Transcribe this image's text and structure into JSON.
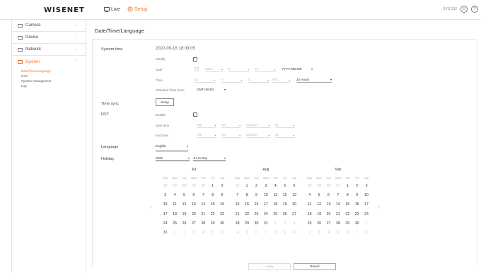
{
  "header": {
    "logo": "WISENET",
    "nav": [
      {
        "label": "Live",
        "icon": "monitor-icon"
      },
      {
        "label": "Setup",
        "icon": "gear-icon"
      }
    ],
    "device_id": "SYS 132",
    "icons": [
      "user-icon",
      "help-icon"
    ]
  },
  "sidebar": {
    "items": [
      {
        "label": "Camera",
        "icon": "camera-icon"
      },
      {
        "label": "Device",
        "icon": "device-icon"
      },
      {
        "label": "Network",
        "icon": "network-icon"
      },
      {
        "label": "System",
        "icon": "system-icon"
      }
    ],
    "submenu": [
      "Date/Time/Language",
      "User",
      "System management",
      "Log"
    ]
  },
  "page": {
    "title": "Date/Time/Language",
    "system_time_label": "System time",
    "system_time_value": "2022-09-16 18:09:05",
    "modify_label": "Modify",
    "date_label": "Date",
    "date_year": "2022",
    "date_month": "9",
    "date_day": "16",
    "date_format": "YYYY-MM-DD",
    "time_label": "Time",
    "time_h": "18",
    "time_m": "9",
    "time_s": "5",
    "time_ampm": "PM",
    "time_format": "24 Hours",
    "tz_label": "Standard Time Zone",
    "tz_value": "GMT+09:00",
    "time_sync_label": "Time sync",
    "setup_button": "Setup",
    "dst_label": "DST",
    "enable_label": "Enable",
    "start_time_label": "Start time",
    "end_time_label": "End time",
    "dst_month": "Mar",
    "dst_week": "1st",
    "dst_day": "Sunday",
    "dst_hour": "01",
    "language_label": "Language",
    "language_value": "English",
    "holiday_label": "Holiday",
    "holiday_year": "2022",
    "holiday_range": "Jul to Sep",
    "apply_button": "Apply",
    "revert_button": "Revert"
  },
  "calendar": {
    "dow": [
      "Sun",
      "Mon",
      "Tue",
      "Wed",
      "Thu",
      "Fri",
      "Sat"
    ],
    "months": [
      {
        "name": "Jul",
        "days": [
          [
            "26",
            "m"
          ],
          [
            "27",
            "m"
          ],
          [
            "28",
            "m"
          ],
          [
            "29",
            "m"
          ],
          [
            "30",
            "m"
          ],
          [
            "1",
            ""
          ],
          [
            "2",
            ""
          ],
          [
            "3",
            ""
          ],
          [
            "4",
            ""
          ],
          [
            "5",
            ""
          ],
          [
            "6",
            ""
          ],
          [
            "7",
            ""
          ],
          [
            "8",
            ""
          ],
          [
            "9",
            ""
          ],
          [
            "10",
            ""
          ],
          [
            "11",
            ""
          ],
          [
            "12",
            ""
          ],
          [
            "13",
            ""
          ],
          [
            "14",
            ""
          ],
          [
            "15",
            ""
          ],
          [
            "16",
            ""
          ],
          [
            "17",
            ""
          ],
          [
            "18",
            ""
          ],
          [
            "19",
            ""
          ],
          [
            "20",
            ""
          ],
          [
            "21",
            ""
          ],
          [
            "22",
            ""
          ],
          [
            "23",
            ""
          ],
          [
            "24",
            ""
          ],
          [
            "25",
            ""
          ],
          [
            "26",
            ""
          ],
          [
            "27",
            ""
          ],
          [
            "28",
            ""
          ],
          [
            "29",
            ""
          ],
          [
            "30",
            ""
          ],
          [
            "31",
            ""
          ],
          [
            "1",
            "m"
          ],
          [
            "2",
            "m"
          ],
          [
            "3",
            "m"
          ],
          [
            "4",
            "m"
          ],
          [
            "5",
            "m"
          ],
          [
            "6",
            "m"
          ]
        ]
      },
      {
        "name": "Aug",
        "days": [
          [
            "31",
            "m"
          ],
          [
            "1",
            ""
          ],
          [
            "2",
            ""
          ],
          [
            "3",
            ""
          ],
          [
            "4",
            ""
          ],
          [
            "5",
            ""
          ],
          [
            "6",
            ""
          ],
          [
            "7",
            ""
          ],
          [
            "8",
            ""
          ],
          [
            "9",
            ""
          ],
          [
            "10",
            ""
          ],
          [
            "11",
            ""
          ],
          [
            "12",
            ""
          ],
          [
            "13",
            ""
          ],
          [
            "14",
            ""
          ],
          [
            "15",
            ""
          ],
          [
            "16",
            ""
          ],
          [
            "17",
            ""
          ],
          [
            "18",
            ""
          ],
          [
            "19",
            ""
          ],
          [
            "20",
            ""
          ],
          [
            "21",
            ""
          ],
          [
            "22",
            ""
          ],
          [
            "23",
            ""
          ],
          [
            "24",
            ""
          ],
          [
            "25",
            ""
          ],
          [
            "26",
            ""
          ],
          [
            "27",
            ""
          ],
          [
            "28",
            ""
          ],
          [
            "29",
            ""
          ],
          [
            "30",
            ""
          ],
          [
            "31",
            ""
          ],
          [
            "1",
            "m"
          ],
          [
            "2",
            "m"
          ],
          [
            "3",
            "m"
          ],
          [
            "4",
            "m"
          ],
          [
            "5",
            "m"
          ],
          [
            "6",
            "m"
          ],
          [
            "7",
            "m"
          ],
          [
            "8",
            "m"
          ],
          [
            "9",
            "m"
          ],
          [
            "10",
            "m"
          ]
        ]
      },
      {
        "name": "Sep",
        "days": [
          [
            "28",
            "m"
          ],
          [
            "29",
            "m"
          ],
          [
            "30",
            "m"
          ],
          [
            "31",
            "m"
          ],
          [
            "1",
            ""
          ],
          [
            "2",
            ""
          ],
          [
            "3",
            ""
          ],
          [
            "4",
            ""
          ],
          [
            "5",
            ""
          ],
          [
            "6",
            ""
          ],
          [
            "7",
            ""
          ],
          [
            "8",
            ""
          ],
          [
            "9",
            ""
          ],
          [
            "10",
            ""
          ],
          [
            "11",
            ""
          ],
          [
            "12",
            ""
          ],
          [
            "13",
            ""
          ],
          [
            "14",
            ""
          ],
          [
            "15",
            ""
          ],
          [
            "16",
            ""
          ],
          [
            "17",
            ""
          ],
          [
            "18",
            ""
          ],
          [
            "19",
            ""
          ],
          [
            "20",
            ""
          ],
          [
            "21",
            ""
          ],
          [
            "22",
            ""
          ],
          [
            "23",
            ""
          ],
          [
            "24",
            ""
          ],
          [
            "25",
            ""
          ],
          [
            "26",
            ""
          ],
          [
            "27",
            ""
          ],
          [
            "28",
            ""
          ],
          [
            "29",
            ""
          ],
          [
            "30",
            ""
          ],
          [
            "1",
            "m"
          ],
          [
            "2",
            "m"
          ],
          [
            "3",
            "m"
          ],
          [
            "4",
            "m"
          ],
          [
            "5",
            "m"
          ],
          [
            "6",
            "m"
          ],
          [
            "7",
            "m"
          ],
          [
            "8",
            "m"
          ]
        ]
      }
    ],
    "prev": "‹",
    "next": "›"
  },
  "colors": {
    "accent": "#f37321",
    "border": "#e3e3e3"
  }
}
